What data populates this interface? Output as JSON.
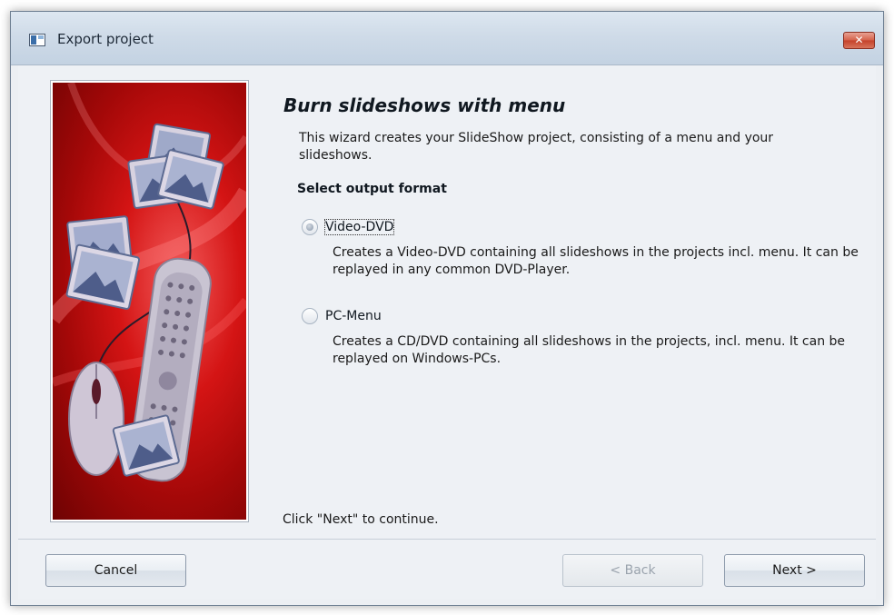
{
  "window": {
    "title": "Export project",
    "close_label": "✕"
  },
  "main": {
    "heading": "Burn slideshows with menu",
    "intro": "This wizard creates your SlideShow project, consisting of a menu and your slideshows.",
    "section_label": "Select output format",
    "options": [
      {
        "label": "Video-DVD",
        "checked": true,
        "description": "Creates a Video-DVD containing all slideshows in the projects incl. menu. It can be replayed in any common DVD-Player."
      },
      {
        "label": "PC-Menu",
        "checked": false,
        "description": "Creates a CD/DVD containing all slideshows in the projects, incl. menu. It can be replayed on Windows-PCs."
      }
    ],
    "continue_text": "Click \"Next\" to continue."
  },
  "footer": {
    "cancel_label": "Cancel",
    "back_label": "< Back",
    "next_label": "Next >"
  },
  "icons": {
    "app": "app-window-icon",
    "close": "close-icon"
  },
  "colors": {
    "image_red": "#d41414",
    "close_button": "#c4412a"
  }
}
